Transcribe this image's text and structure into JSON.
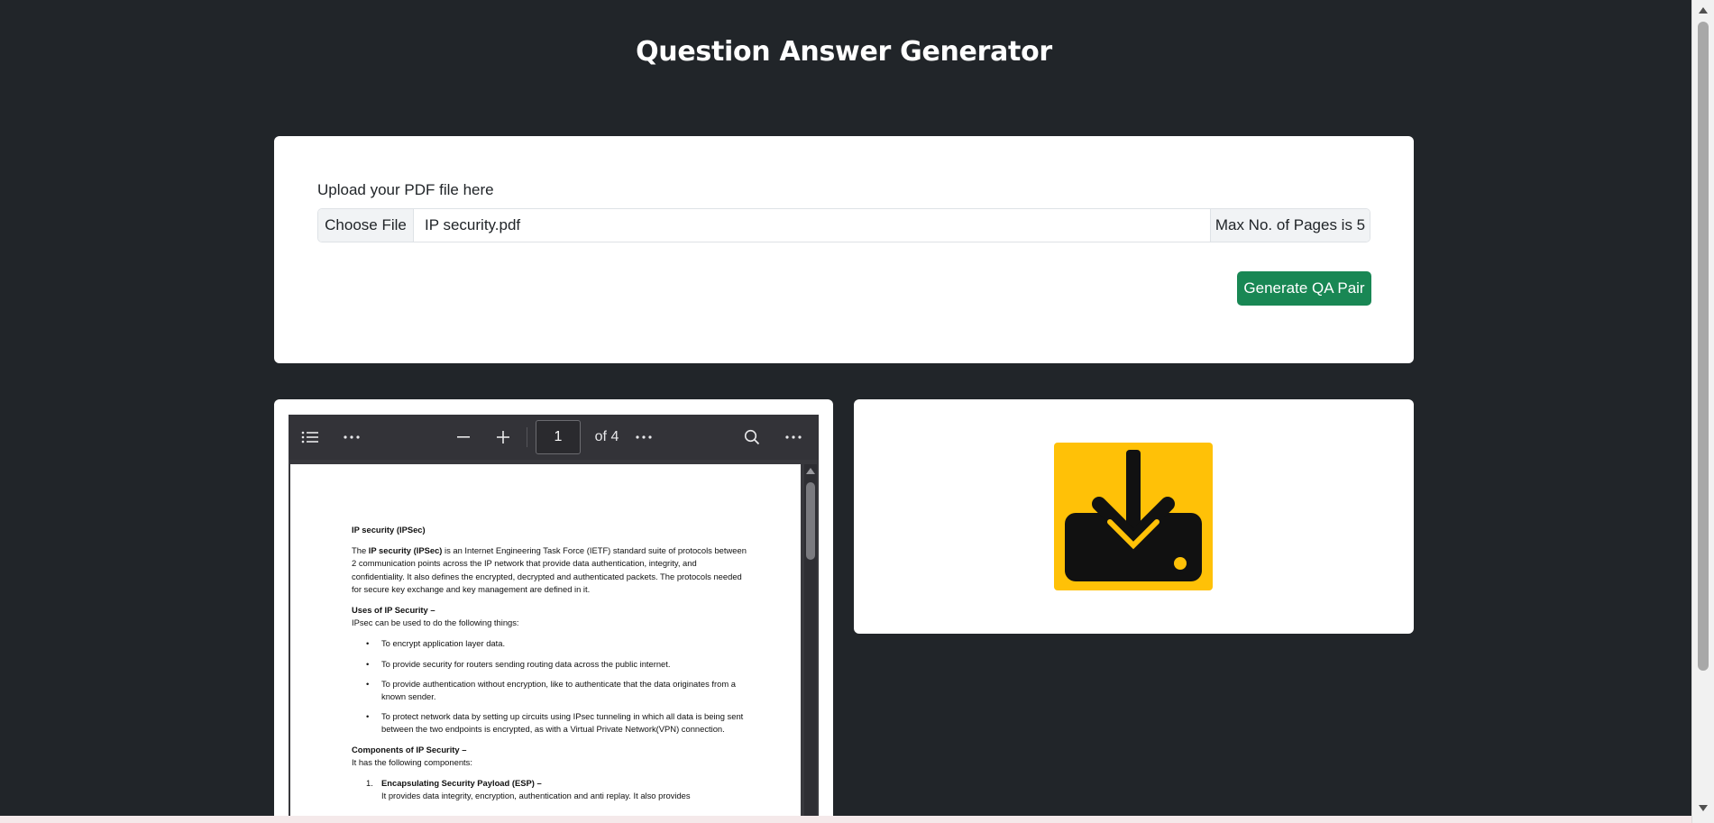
{
  "header": {
    "title": "Question Answer Generator"
  },
  "upload": {
    "label": "Upload your PDF file here",
    "choose_button": "Choose File",
    "file_name": "IP security.pdf",
    "max_pages_note": "Max No. of Pages is 5",
    "generate_button": "Generate QA Pair",
    "generate_color": "#198754"
  },
  "pdf_viewer": {
    "page_number": "1",
    "page_total": "of 4",
    "icons": [
      "sidebar-toggle-icon",
      "more-icon",
      "zoom-out-icon",
      "zoom-in-icon",
      "more-icon",
      "search-icon",
      "more-icon"
    ],
    "document": {
      "heading": "IP security (IPSec)",
      "intro_prefix": "The ",
      "intro_bold": "IP security (IPSec)",
      "intro_rest": " is an Internet Engineering Task Force (IETF) standard suite of protocols between 2 communication points across the IP network that provide data authentication, integrity, and confidentiality. It also defines the encrypted, decrypted and authenticated packets. The protocols needed for secure key exchange and key management are defined in it.",
      "uses_heading": "Uses of IP Security –",
      "uses_intro": "IPsec can be used to do the following things:",
      "uses": [
        "To encrypt application layer data.",
        "To provide security for routers sending routing data across the public internet.",
        "To provide authentication without encryption, like to authenticate that the data originates from a known sender.",
        "To protect network data by setting up circuits using IPsec tunneling in which all data is being sent between the two endpoints is encrypted, as with a Virtual Private Network(VPN) connection."
      ],
      "components_heading": "Components of IP Security –",
      "components_intro": "It has the following components:",
      "component_1_num": "1.",
      "component_1_title": "Encapsulating Security Payload (ESP) –",
      "component_1_text": "It provides data integrity, encryption, authentication and anti replay. It also provides"
    }
  },
  "download": {
    "icon": "download-icon",
    "background": "#ffc107"
  }
}
